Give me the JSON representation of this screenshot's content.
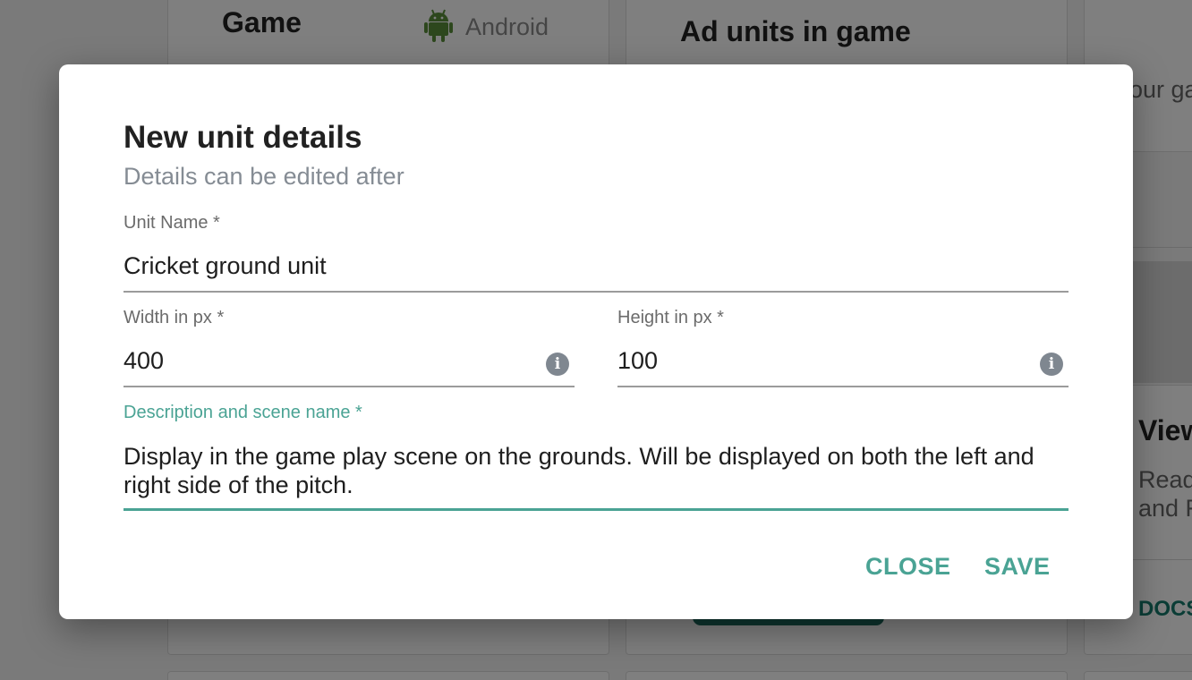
{
  "background": {
    "game_card": {
      "title": "Game",
      "platform": "Android"
    },
    "ad_units_card": {
      "title": "Ad units in game",
      "fragment": "our ga"
    },
    "view_card": {
      "title": "View",
      "line1": "Read",
      "line2": "and F",
      "docs": "DOCS"
    }
  },
  "dialog": {
    "title": "New unit details",
    "subtitle": "Details can be edited after",
    "unit_name": {
      "label": "Unit Name *",
      "value": "Cricket ground unit"
    },
    "width": {
      "label": "Width in px *",
      "value": "400",
      "icon": "info-icon"
    },
    "height": {
      "label": "Height in px *",
      "value": "100",
      "icon": "info-icon"
    },
    "description": {
      "label": "Description and scene name *",
      "value": "Display in the game play scene on the grounds. Will be displayed on both the left and right side of the pitch."
    },
    "buttons": {
      "close": "CLOSE",
      "save": "SAVE"
    }
  },
  "colors": {
    "accent": "#4aa394",
    "android_green": "#5a8f3a",
    "overlay": "rgba(0,0,0,0.5)"
  }
}
